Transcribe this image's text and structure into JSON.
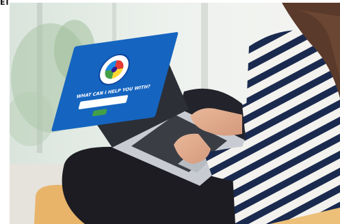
{
  "corner_label": "EI",
  "laptop_screen": {
    "prompt_text": "WHAT CAN I HELP YOU WITH?",
    "search_placeholder": "",
    "go_button_label": ""
  },
  "colors": {
    "screen_blue": "#1565c0",
    "button_green": "#43a047",
    "shirt_navy": "#1a2a4f",
    "jeans_black": "#1c1c22",
    "cushion_orange": "#e7b46a"
  }
}
